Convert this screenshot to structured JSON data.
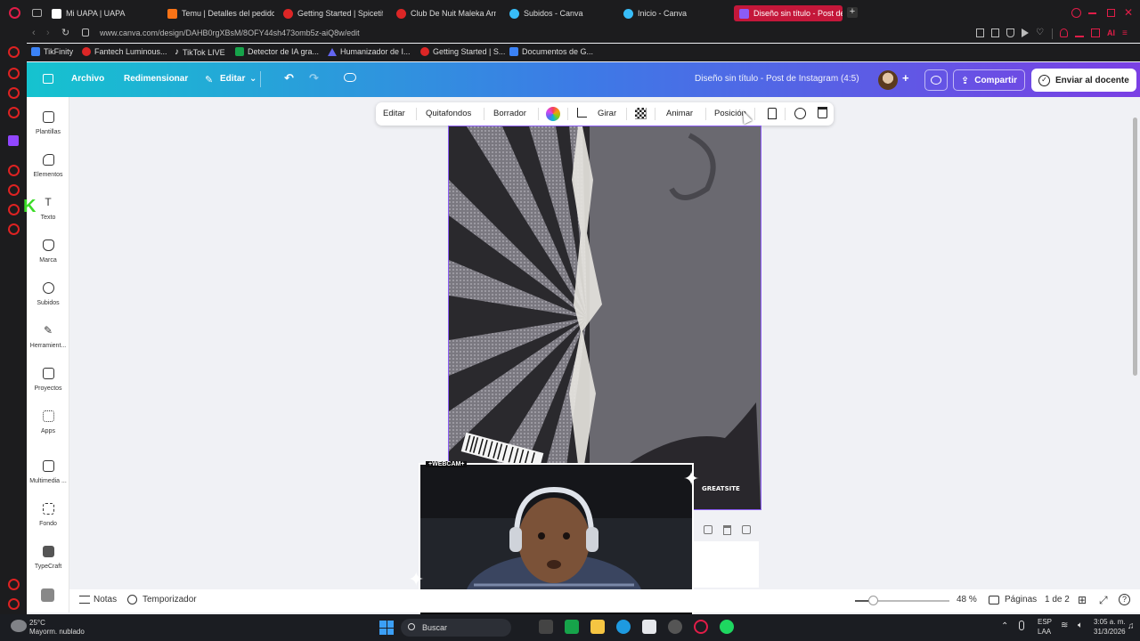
{
  "browser": {
    "tabs": [
      {
        "label": "Mi UAPA | UAPA",
        "color": "#ffffff"
      },
      {
        "label": "Temu | Detalles del pedido",
        "color": "#f97316"
      },
      {
        "label": "Getting Started | Spicetify",
        "color": "#dc2626"
      },
      {
        "label": "Club De Nuit Maleka Arma",
        "color": "#dc2626"
      },
      {
        "label": "Subidos - Canva",
        "color": "#38bdf8"
      },
      {
        "label": "Inicio - Canva",
        "color": "#38bdf8"
      },
      {
        "label": "Diseño sin título - Post de",
        "color": "#8b5cf6",
        "active": true
      }
    ],
    "url": "www.canva.com/design/DAHB0rgXBsM/8OFY44sh473omb5z-aiQ8w/edit",
    "bookmarks": [
      {
        "label": "TikFinity",
        "color": "#3b82f6"
      },
      {
        "label": "Fantech Luminous...",
        "color": "#dc2626"
      },
      {
        "label": "TikTok LIVE",
        "color": "#111111"
      },
      {
        "label": "Detector de IA gra...",
        "color": "#16a34a"
      },
      {
        "label": "Humanizador de I...",
        "color": "#6366f1"
      },
      {
        "label": "Getting Started | S...",
        "color": "#dc2626"
      },
      {
        "label": "Documentos de G...",
        "color": "#3b82f6"
      }
    ],
    "ai_label": "AI"
  },
  "header": {
    "archivo": "Archivo",
    "redimensionar": "Redimensionar",
    "editar": "Editar",
    "doc_title": "Diseño sin título - Post de Instagram (4:5)",
    "share": "Compartir",
    "send": "Enviar al docente"
  },
  "sidebar": {
    "items": [
      {
        "label": "Plantillas"
      },
      {
        "label": "Elementos"
      },
      {
        "label": "Texto"
      },
      {
        "label": "Marca"
      },
      {
        "label": "Subidos"
      },
      {
        "label": "Herramient..."
      },
      {
        "label": "Proyectos"
      },
      {
        "label": "Apps"
      },
      {
        "label": "Multimedia ..."
      },
      {
        "label": "Fondo"
      },
      {
        "label": "TypeCraft"
      }
    ]
  },
  "toolbar": {
    "editar": "Editar",
    "quitafondos": "Quitafondos",
    "borrador": "Borrador",
    "girar": "Girar",
    "animar": "Animar",
    "posicion": "Posición"
  },
  "design": {
    "sticker_text": "GREATSITE",
    "webcam_label": "+WEBCAM+"
  },
  "bottom": {
    "notas": "Notas",
    "temporizador": "Temporizador",
    "zoom_percent": 48,
    "zoom_label": "48 %",
    "paginas": "Páginas",
    "page_count": "1 de 2"
  },
  "taskbar": {
    "temp": "25°C",
    "weather": "Mayorm. nublado",
    "search": "Buscar",
    "lang1": "ESP",
    "lang2": "LAA",
    "time": "3:05 a. m.",
    "date": "31/3/2026"
  }
}
